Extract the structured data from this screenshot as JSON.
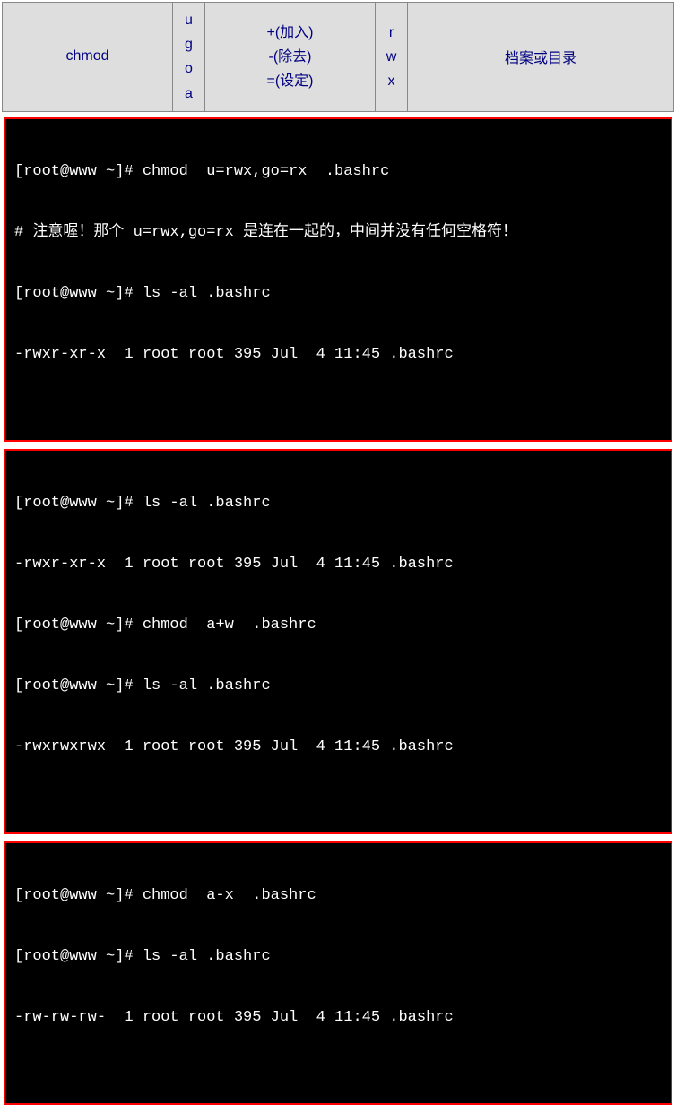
{
  "syntax": {
    "cmd": "chmod",
    "ugoa": [
      "u",
      "g",
      "o",
      "a"
    ],
    "ops": [
      "+(加入)",
      "-(除去)",
      "=(设定)"
    ],
    "rwx": [
      "r",
      "w",
      "x"
    ],
    "target": "档案或目录"
  },
  "terminals": [
    {
      "lines": [
        "[root@www ~]# chmod  u=rwx,go=rx  .bashrc",
        "# 注意喔！那个 u=rwx,go=rx 是连在一起的，中间并没有任何空格符！",
        "[root@www ~]# ls -al .bashrc",
        "-rwxr-xr-x  1 root root 395 Jul  4 11:45 .bashrc"
      ]
    },
    {
      "lines": [
        "[root@www ~]# ls -al .bashrc",
        "-rwxr-xr-x  1 root root 395 Jul  4 11:45 .bashrc",
        "[root@www ~]# chmod  a+w  .bashrc",
        "[root@www ~]# ls -al .bashrc",
        "-rwxrwxrwx  1 root root 395 Jul  4 11:45 .bashrc"
      ]
    },
    {
      "lines": [
        "[root@www ~]# chmod  a-x  .bashrc",
        "[root@www ~]# ls -al .bashrc",
        "-rw-rw-rw-  1 root root 395 Jul  4 11:45 .bashrc"
      ]
    }
  ]
}
